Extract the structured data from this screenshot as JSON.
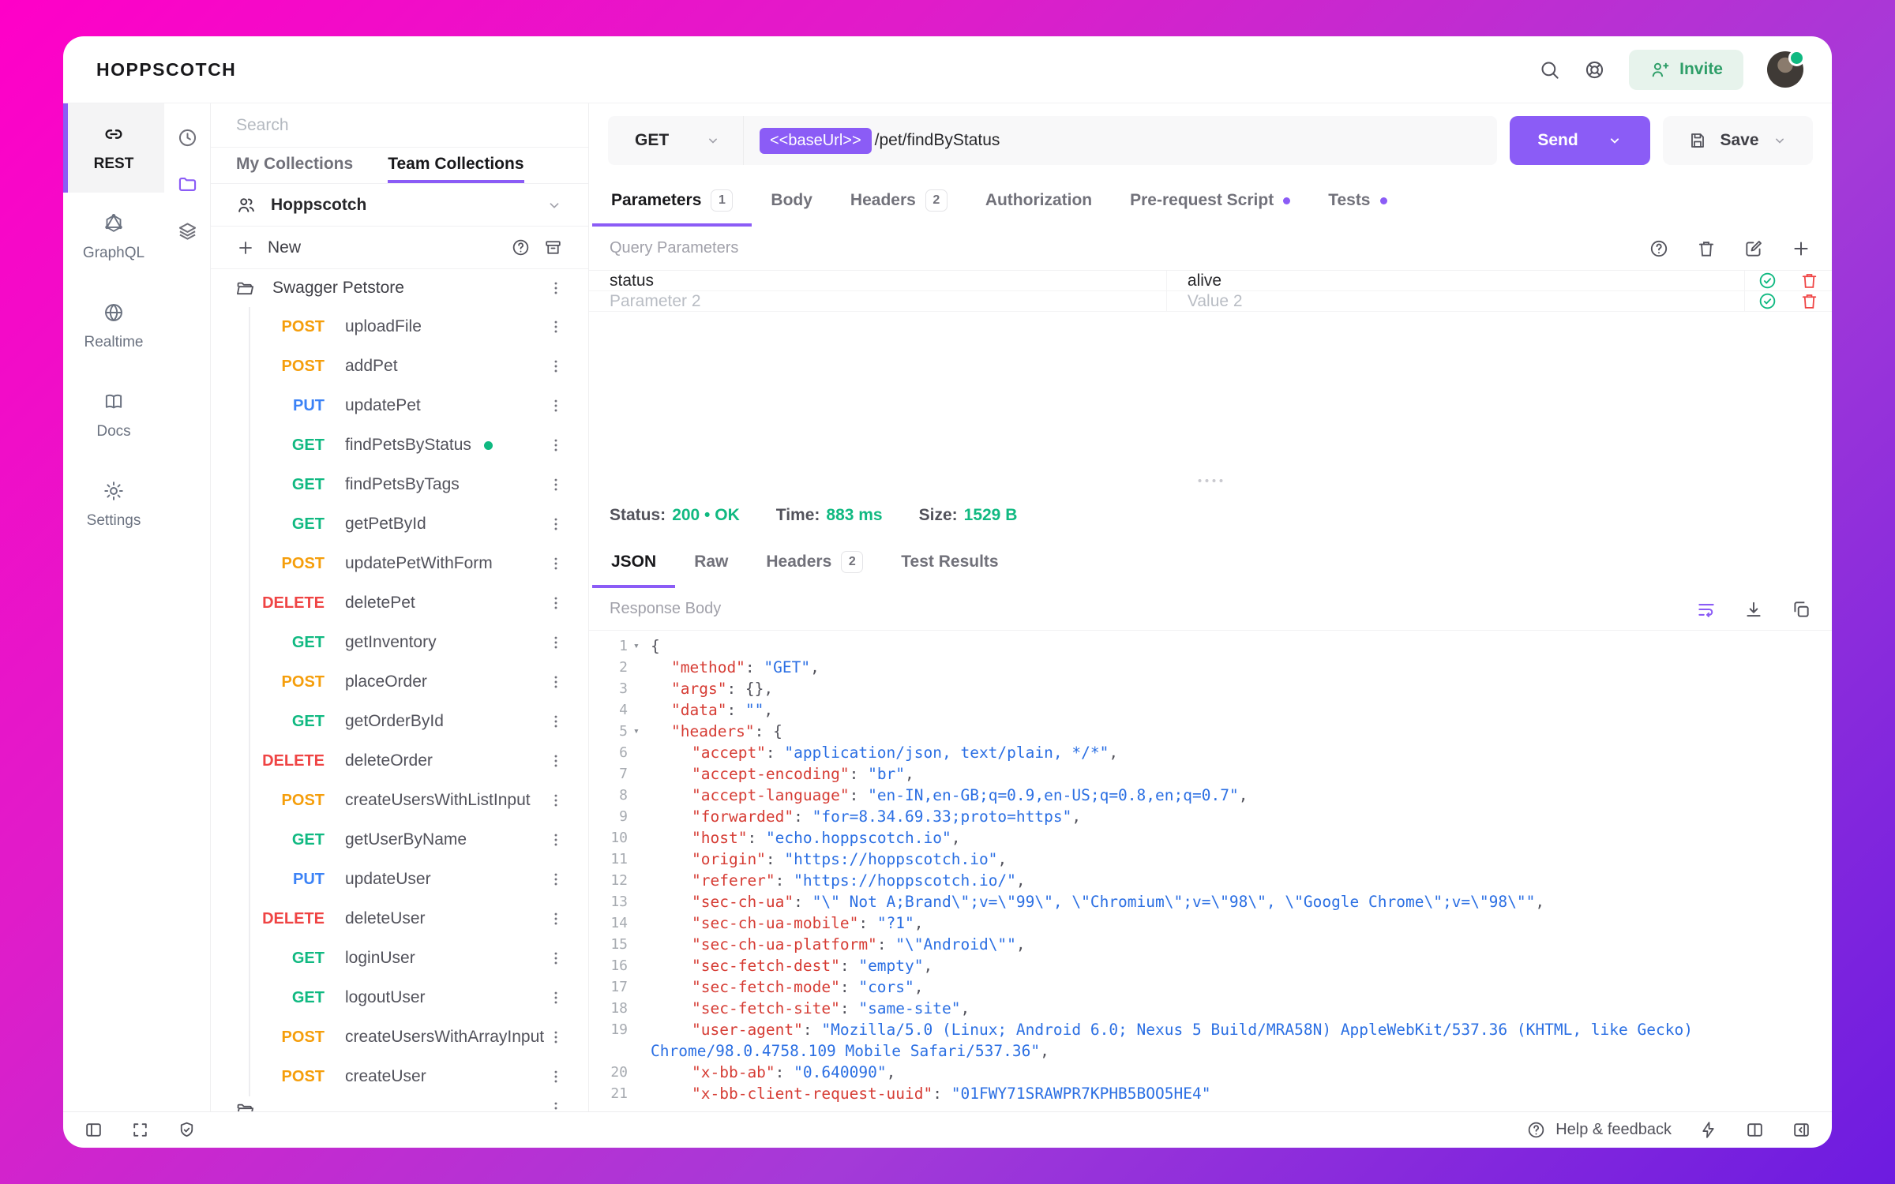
{
  "app": {
    "title": "HOPPSCOTCH"
  },
  "topbar": {
    "invite_label": "Invite"
  },
  "primary_nav": {
    "items": [
      {
        "label": "REST",
        "icon": "link-icon",
        "active": true
      },
      {
        "label": "GraphQL",
        "icon": "graphql-icon",
        "active": false
      },
      {
        "label": "Realtime",
        "icon": "globe-icon",
        "active": false
      },
      {
        "label": "Docs",
        "icon": "book-open-icon",
        "active": false
      },
      {
        "label": "Settings",
        "icon": "gear-icon",
        "active": false
      }
    ]
  },
  "panel_tabs": [
    {
      "icon": "history-clock-icon",
      "active": false
    },
    {
      "icon": "collections-folder-icon",
      "active": true
    },
    {
      "icon": "environments-layers-icon",
      "active": false
    }
  ],
  "collections": {
    "search_placeholder": "Search",
    "tabs": [
      {
        "label": "My Collections",
        "active": false
      },
      {
        "label": "Team Collections",
        "active": true
      }
    ],
    "team_name": "Hoppscotch",
    "new_label": "New",
    "collection_name": "Swagger Petstore",
    "requests": [
      {
        "method": "POST",
        "name": "uploadFile"
      },
      {
        "method": "POST",
        "name": "addPet"
      },
      {
        "method": "PUT",
        "name": "updatePet"
      },
      {
        "method": "GET",
        "name": "findPetsByStatus",
        "active": true
      },
      {
        "method": "GET",
        "name": "findPetsByTags"
      },
      {
        "method": "GET",
        "name": "getPetById"
      },
      {
        "method": "POST",
        "name": "updatePetWithForm"
      },
      {
        "method": "DELETE",
        "name": "deletePet"
      },
      {
        "method": "GET",
        "name": "getInventory"
      },
      {
        "method": "POST",
        "name": "placeOrder"
      },
      {
        "method": "GET",
        "name": "getOrderById"
      },
      {
        "method": "DELETE",
        "name": "deleteOrder"
      },
      {
        "method": "POST",
        "name": "createUsersWithListInput"
      },
      {
        "method": "GET",
        "name": "getUserByName"
      },
      {
        "method": "PUT",
        "name": "updateUser"
      },
      {
        "method": "DELETE",
        "name": "deleteUser"
      },
      {
        "method": "GET",
        "name": "loginUser"
      },
      {
        "method": "GET",
        "name": "logoutUser"
      },
      {
        "method": "POST",
        "name": "createUsersWithArrayInput"
      },
      {
        "method": "POST",
        "name": "createUser"
      }
    ]
  },
  "request": {
    "method": "GET",
    "url_base": "<<baseUrl>>",
    "url_path": "/pet/findByStatus",
    "send_label": "Send",
    "save_label": "Save",
    "tabs": [
      {
        "label": "Parameters",
        "badge": "1",
        "active": true
      },
      {
        "label": "Body"
      },
      {
        "label": "Headers",
        "badge": "2"
      },
      {
        "label": "Authorization"
      },
      {
        "label": "Pre-request Script",
        "dot": true
      },
      {
        "label": "Tests",
        "dot": true
      }
    ],
    "section_title": "Query Parameters",
    "params": [
      {
        "key": "status",
        "value": "alive",
        "placeholder": false
      },
      {
        "key": "Parameter 2",
        "value": "Value 2",
        "placeholder": true
      }
    ]
  },
  "response": {
    "status_label": "Status:",
    "status_value": "200 • OK",
    "time_label": "Time:",
    "time_value": "883 ms",
    "size_label": "Size:",
    "size_value": "1529 B",
    "tabs": [
      {
        "label": "JSON",
        "active": true
      },
      {
        "label": "Raw"
      },
      {
        "label": "Headers",
        "badge": "2"
      },
      {
        "label": "Test Results"
      }
    ],
    "body_label": "Response Body",
    "code_lines": [
      {
        "n": "1",
        "fold": true,
        "indent": 0,
        "tokens": [
          [
            "p",
            "{"
          ]
        ]
      },
      {
        "n": "2",
        "indent": 1,
        "tokens": [
          [
            "k",
            "\"method\""
          ],
          [
            "p",
            ": "
          ],
          [
            "s",
            "\"GET\""
          ],
          [
            "p",
            ","
          ]
        ]
      },
      {
        "n": "3",
        "indent": 1,
        "tokens": [
          [
            "k",
            "\"args\""
          ],
          [
            "p",
            ": {},"
          ]
        ]
      },
      {
        "n": "4",
        "indent": 1,
        "tokens": [
          [
            "k",
            "\"data\""
          ],
          [
            "p",
            ": "
          ],
          [
            "s",
            "\"\""
          ],
          [
            "p",
            ","
          ]
        ]
      },
      {
        "n": "5",
        "fold": true,
        "indent": 1,
        "tokens": [
          [
            "k",
            "\"headers\""
          ],
          [
            "p",
            ": {"
          ]
        ]
      },
      {
        "n": "6",
        "indent": 2,
        "tokens": [
          [
            "k",
            "\"accept\""
          ],
          [
            "p",
            ": "
          ],
          [
            "s",
            "\"application/json, text/plain, */*\""
          ],
          [
            "p",
            ","
          ]
        ]
      },
      {
        "n": "7",
        "indent": 2,
        "tokens": [
          [
            "k",
            "\"accept-encoding\""
          ],
          [
            "p",
            ": "
          ],
          [
            "s",
            "\"br\""
          ],
          [
            "p",
            ","
          ]
        ]
      },
      {
        "n": "8",
        "indent": 2,
        "tokens": [
          [
            "k",
            "\"accept-language\""
          ],
          [
            "p",
            ": "
          ],
          [
            "s",
            "\"en-IN,en-GB;q=0.9,en-US;q=0.8,en;q=0.7\""
          ],
          [
            "p",
            ","
          ]
        ]
      },
      {
        "n": "9",
        "indent": 2,
        "tokens": [
          [
            "k",
            "\"forwarded\""
          ],
          [
            "p",
            ": "
          ],
          [
            "s",
            "\"for=8.34.69.33;proto=https\""
          ],
          [
            "p",
            ","
          ]
        ]
      },
      {
        "n": "10",
        "indent": 2,
        "tokens": [
          [
            "k",
            "\"host\""
          ],
          [
            "p",
            ": "
          ],
          [
            "s",
            "\"echo.hoppscotch.io\""
          ],
          [
            "p",
            ","
          ]
        ]
      },
      {
        "n": "11",
        "indent": 2,
        "tokens": [
          [
            "k",
            "\"origin\""
          ],
          [
            "p",
            ": "
          ],
          [
            "s",
            "\"https://hoppscotch.io\""
          ],
          [
            "p",
            ","
          ]
        ]
      },
      {
        "n": "12",
        "indent": 2,
        "tokens": [
          [
            "k",
            "\"referer\""
          ],
          [
            "p",
            ": "
          ],
          [
            "s",
            "\"https://hoppscotch.io/\""
          ],
          [
            "p",
            ","
          ]
        ]
      },
      {
        "n": "13",
        "indent": 2,
        "tokens": [
          [
            "k",
            "\"sec-ch-ua\""
          ],
          [
            "p",
            ": "
          ],
          [
            "s",
            "\"\\\" Not A;Brand\\\";v=\\\"99\\\", \\\"Chromium\\\";v=\\\"98\\\", \\\"Google Chrome\\\";v=\\\"98\\\"\""
          ],
          [
            "p",
            ","
          ]
        ]
      },
      {
        "n": "14",
        "indent": 2,
        "tokens": [
          [
            "k",
            "\"sec-ch-ua-mobile\""
          ],
          [
            "p",
            ": "
          ],
          [
            "s",
            "\"?1\""
          ],
          [
            "p",
            ","
          ]
        ]
      },
      {
        "n": "15",
        "indent": 2,
        "tokens": [
          [
            "k",
            "\"sec-ch-ua-platform\""
          ],
          [
            "p",
            ": "
          ],
          [
            "s",
            "\"\\\"Android\\\"\""
          ],
          [
            "p",
            ","
          ]
        ]
      },
      {
        "n": "16",
        "indent": 2,
        "tokens": [
          [
            "k",
            "\"sec-fetch-dest\""
          ],
          [
            "p",
            ": "
          ],
          [
            "s",
            "\"empty\""
          ],
          [
            "p",
            ","
          ]
        ]
      },
      {
        "n": "17",
        "indent": 2,
        "tokens": [
          [
            "k",
            "\"sec-fetch-mode\""
          ],
          [
            "p",
            ": "
          ],
          [
            "s",
            "\"cors\""
          ],
          [
            "p",
            ","
          ]
        ]
      },
      {
        "n": "18",
        "indent": 2,
        "tokens": [
          [
            "k",
            "\"sec-fetch-site\""
          ],
          [
            "p",
            ": "
          ],
          [
            "s",
            "\"same-site\""
          ],
          [
            "p",
            ","
          ]
        ]
      },
      {
        "n": "19",
        "indent": 2,
        "tokens": [
          [
            "k",
            "\"user-agent\""
          ],
          [
            "p",
            ": "
          ],
          [
            "s",
            "\"Mozilla/5.0 (Linux; Android 6.0; Nexus 5 Build/MRA58N) AppleWebKit/537.36 (KHTML, like Gecko)"
          ]
        ]
      },
      {
        "n": "",
        "indent": 0,
        "tokens": [
          [
            "s",
            "Chrome/98.0.4758.109 Mobile Safari/537.36\""
          ],
          [
            "p",
            ","
          ]
        ]
      },
      {
        "n": "20",
        "indent": 2,
        "tokens": [
          [
            "k",
            "\"x-bb-ab\""
          ],
          [
            "p",
            ": "
          ],
          [
            "s",
            "\"0.640090\""
          ],
          [
            "p",
            ","
          ]
        ]
      },
      {
        "n": "21",
        "indent": 2,
        "tokens": [
          [
            "k",
            "\"x-bb-client-request-uuid\""
          ],
          [
            "p",
            ": "
          ],
          [
            "s",
            "\"01FWY71SRAWPR7KPHB5BOO5HE4\""
          ]
        ]
      }
    ]
  },
  "footer": {
    "help_label": "Help & feedback"
  },
  "colors": {
    "accent": "#8B5CF6",
    "get": "#10B981",
    "post": "#F59E0B",
    "put": "#3B82F6",
    "delete": "#EF4444",
    "status_ok": "#10B981",
    "invite_green": "#2E9E68",
    "json_key": "#D63C34",
    "json_string": "#2B6FE3"
  }
}
